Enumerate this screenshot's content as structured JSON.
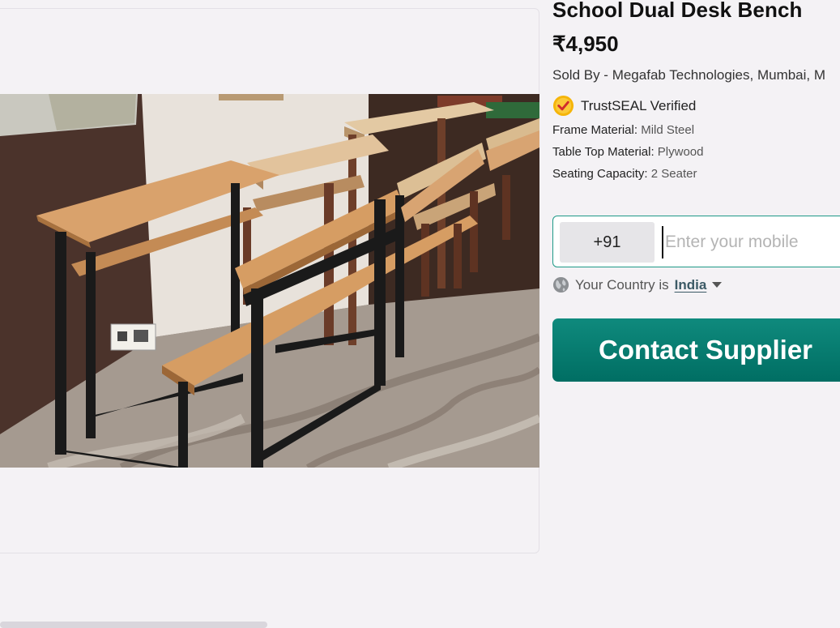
{
  "product": {
    "title": "School Dual Desk Bench",
    "price": "₹4,950",
    "sold_by": "Sold By - Megafab Technologies, Mumbai, M",
    "trust_badge": "TrustSEAL Verified",
    "specs": [
      {
        "label": "Frame Material:",
        "value": "Mild Steel"
      },
      {
        "label": "Table Top Material:",
        "value": "Plywood"
      },
      {
        "label": "Seating Capacity:",
        "value": "2 Seater"
      }
    ]
  },
  "enquiry": {
    "country_code": "+91",
    "mobile_placeholder": "Enter your mobile",
    "country_prefix": "Your Country is",
    "country_name": "India",
    "contact_label": "Contact Supplier"
  },
  "icons": {
    "trust": "trustseal-check-icon",
    "globe": "globe-icon",
    "caret": "chevron-down-icon"
  },
  "colors": {
    "accent": "#00786c",
    "badge": "#f5b50a"
  }
}
